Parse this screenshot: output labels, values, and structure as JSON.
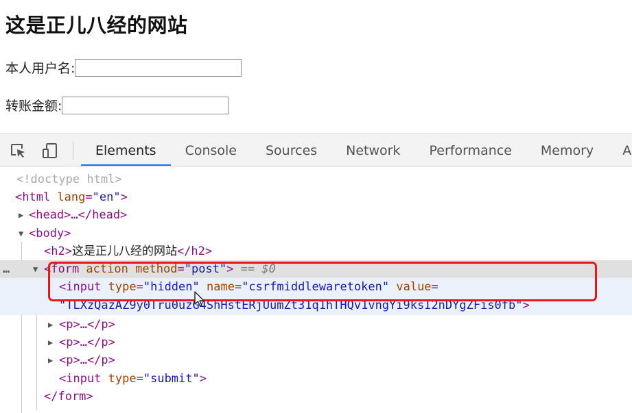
{
  "page": {
    "heading": "这是正儿八经的网站",
    "username_label": "本人用户名:",
    "amount_label": "转账金额:"
  },
  "devtools": {
    "toolbar_icons": [
      "inspect-element-icon",
      "device-toolbar-icon"
    ],
    "tabs": [
      {
        "label": "Elements",
        "active": true
      },
      {
        "label": "Console"
      },
      {
        "label": "Sources"
      },
      {
        "label": "Network"
      },
      {
        "label": "Performance"
      },
      {
        "label": "Memory"
      },
      {
        "label": "Ap"
      }
    ],
    "code": {
      "doctype": "<!doctype html>",
      "html_open": "<html",
      "lang_attr": " lang",
      "lang_val": "\"en\"",
      "html_close_bracket": ">",
      "head": "<head>…</head>",
      "body": "<body>",
      "h2_open": "<h2>",
      "h2_text": "这是正儿八经的网站",
      "h2_close": "</h2>",
      "form_open": "<form",
      "form_action": " action",
      "form_method": " method",
      "form_eq": "=",
      "form_method_val": "\"post\"",
      "form_close_bracket": ">",
      "form_selected_marker": " == $0",
      "input_open": "<input",
      "input_type": " type",
      "input_type_val": "\"hidden\"",
      "input_name": " name",
      "input_name_val": "\"csrfmiddlewaretoken\"",
      "input_value": " value",
      "input_value_val": "\"TLXzQazAZ9y0Tru0uzG4ShHstERjUumZt31q1hTHQv1vngYi9ksI2nDYgZFis0fb\"",
      "input_close_bracket": ">",
      "p_collapsed": "<p>…</p>",
      "submit_open": "<input",
      "submit_type": " type",
      "submit_type_val": "\"submit\"",
      "submit_close_bracket": ">",
      "form_end": "</form>",
      "ellipsis": "…",
      "eq_sign": "="
    }
  }
}
